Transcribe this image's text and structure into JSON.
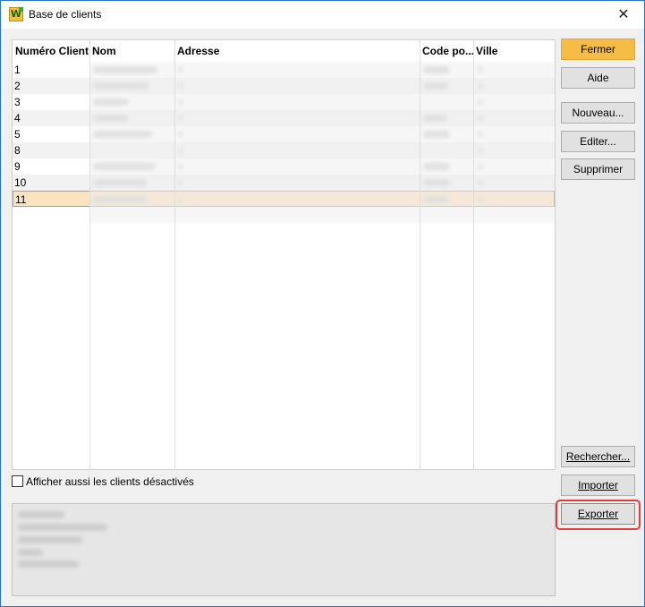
{
  "window": {
    "title": "Base de clients",
    "close_glyph": "✕",
    "icon_letter": "W",
    "icon": "app-logo-icon"
  },
  "grid": {
    "columns": [
      "Numéro Client",
      "Nom",
      "Adresse",
      "Code po...",
      "Ville"
    ],
    "rows": [
      {
        "num": "1"
      },
      {
        "num": "2"
      },
      {
        "num": "3"
      },
      {
        "num": "4"
      },
      {
        "num": "5"
      },
      {
        "num": "8"
      },
      {
        "num": "9"
      },
      {
        "num": "10"
      },
      {
        "num": "11",
        "selected": true
      }
    ]
  },
  "buttons": {
    "close": "Fermer",
    "help": "Aide",
    "new": "Nouveau...",
    "edit": "Editer...",
    "delete": "Supprimer",
    "search": "Rechercher...",
    "import": "Importer",
    "export": "Exporter"
  },
  "options": {
    "show_disabled": "Afficher aussi les clients désactivés"
  },
  "colors": {
    "accent": "#f5bd45",
    "selection": "#fbe3bf",
    "highlight": "#e53b3b",
    "title_border": "#2b73c8"
  }
}
